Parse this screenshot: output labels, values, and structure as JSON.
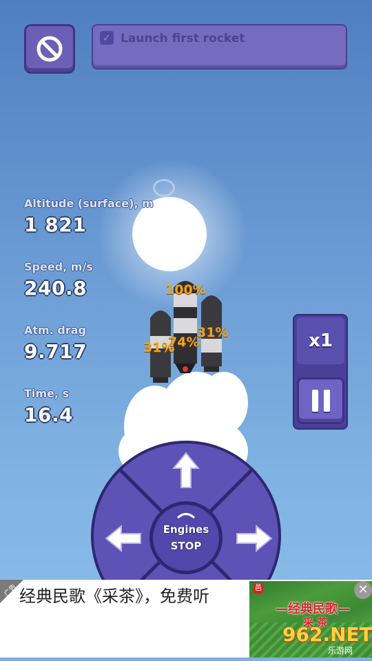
{
  "mission": {
    "checked": true,
    "text": "Launch first rocket"
  },
  "stats": [
    {
      "label": "Altitude (surface), m",
      "value": "1 821"
    },
    {
      "label": "Speed, m/s",
      "value": "240.8"
    },
    {
      "label": "Atm. drag",
      "value": "9.717"
    },
    {
      "label": "Time, s",
      "value": "16.4"
    }
  ],
  "rocket": {
    "throttle_center": "100%",
    "throttle_left": "31%",
    "throttle_core": "74%",
    "throttle_right": "31%"
  },
  "controls": {
    "speed_multiplier": "x1",
    "engines_line1": "Engines",
    "engines_line2": "STOP"
  },
  "ad": {
    "corner_tag": "广告",
    "text": "经典民歌《采茶》，免费听",
    "image_title": "—经典民歌—",
    "image_subtitle": "采 茶",
    "badge": "邑",
    "close": "✕"
  },
  "watermark": {
    "brand": "962.NET",
    "sub": "乐游网"
  },
  "colors": {
    "sky": "#6a9ad3",
    "panel": "#5d52b6",
    "throttle": "#f5a11a"
  }
}
